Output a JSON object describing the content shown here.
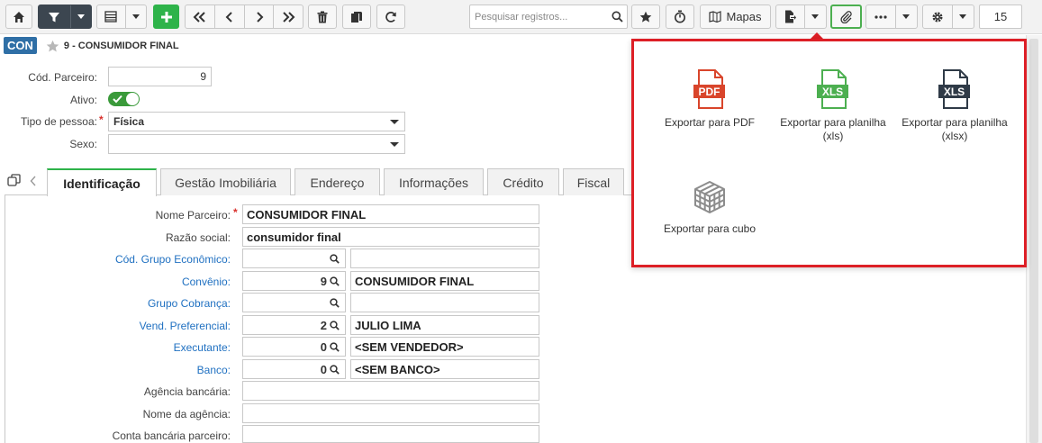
{
  "toolbar": {
    "search_placeholder": "Pesquisar registros...",
    "mapas_label": "Mapas",
    "page_size": "15"
  },
  "record": {
    "badge": "CON",
    "title": "9 - CONSUMIDOR FINAL"
  },
  "header_form": {
    "cod_parceiro_label": "Cód. Parceiro:",
    "cod_parceiro_value": "9",
    "ativo_label": "Ativo:",
    "tipo_pessoa_label": "Tipo de pessoa:",
    "tipo_pessoa_value": "Física",
    "sexo_label": "Sexo:",
    "sexo_value": ""
  },
  "tabs": [
    {
      "label": "Identificação"
    },
    {
      "label": "Gestão Imobiliária"
    },
    {
      "label": "Endereço"
    },
    {
      "label": "Informações"
    },
    {
      "label": "Crédito"
    },
    {
      "label": "Fiscal"
    }
  ],
  "form": {
    "nome_parceiro_label": "Nome Parceiro:",
    "nome_parceiro_value": "CONSUMIDOR FINAL",
    "razao_social_label": "Razão social:",
    "razao_social_value": "consumidor final",
    "grupo_economico_label": "Cód. Grupo Econômico:",
    "grupo_economico_code": "",
    "grupo_economico_desc": "",
    "convenio_label": "Convênio:",
    "convenio_code": "9",
    "convenio_desc": "CONSUMIDOR FINAL",
    "grupo_cobranca_label": "Grupo Cobrança:",
    "grupo_cobranca_code": "",
    "grupo_cobranca_desc": "",
    "vend_pref_label": "Vend. Preferencial:",
    "vend_pref_code": "2",
    "vend_pref_desc": "JULIO LIMA",
    "executante_label": "Executante:",
    "executante_code": "0",
    "executante_desc": "<SEM VENDEDOR>",
    "banco_label": "Banco:",
    "banco_code": "0",
    "banco_desc": "<SEM BANCO>",
    "agencia_label": "Agência bancária:",
    "agencia_value": "",
    "nome_agencia_label": "Nome da agência:",
    "nome_agencia_value": "",
    "conta_label": "Conta bancária parceiro:",
    "conta_value": ""
  },
  "export_menu": {
    "pdf_label": "Exportar para PDF",
    "xls_label": "Exportar para planilha (xls)",
    "xlsx_label": "Exportar para planilha (xlsx)",
    "cube_label": "Exportar para cubo",
    "pdf_icon_text": "PDF",
    "xls_icon_text": "XLS",
    "xlsx_icon_text": "XLS"
  },
  "colors": {
    "pdf": "#d9452b",
    "xls": "#4caf50",
    "xlsx": "#2f3a47",
    "highlight": "#dd1f26",
    "link": "#1f70c1",
    "accent": "#2eb34a"
  }
}
